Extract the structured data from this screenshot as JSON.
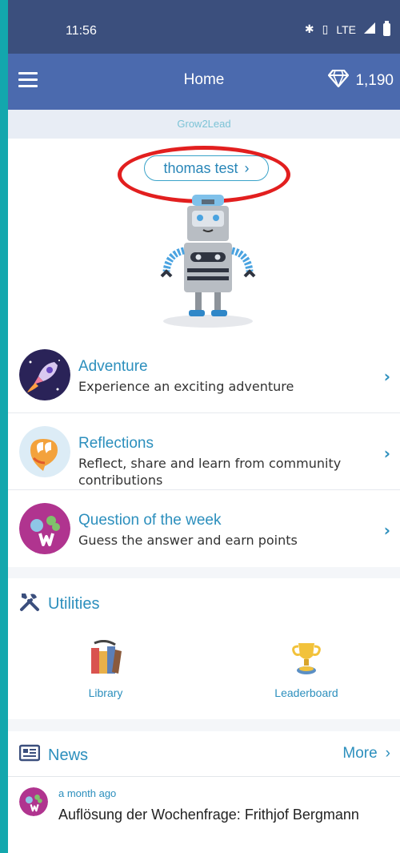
{
  "status_bar": {
    "time": "11:56",
    "network": "LTE"
  },
  "app_bar": {
    "title": "Home",
    "gems": "1,190"
  },
  "organization": "Grow2Lead",
  "profile": {
    "name": "thomas test",
    "chevron": "›"
  },
  "features": [
    {
      "title": "Adventure",
      "description": "Experience an exciting adventure",
      "icon": "rocket-icon"
    },
    {
      "title": "Reflections",
      "description": "Reflect, share and learn from community contributions",
      "icon": "speech-bubble-icon"
    },
    {
      "title": "Question of the week",
      "description": "Guess the answer and earn points",
      "icon": "qow-icon"
    }
  ],
  "utilities": {
    "title": "Utilities",
    "items": [
      {
        "label": "Library",
        "icon": "library-icon"
      },
      {
        "label": "Leaderboard",
        "icon": "trophy-icon"
      }
    ]
  },
  "news": {
    "title": "News",
    "more": "More",
    "items": [
      {
        "time": "a month ago",
        "title": "Auflösung der Wochenfrage: Frithjof Bergmann"
      }
    ]
  },
  "colors": {
    "status_bar": "#3b4f7d",
    "app_bar": "#4b6aae",
    "accent": "#2c8fbd",
    "highlight_ring": "#e21f1f"
  }
}
